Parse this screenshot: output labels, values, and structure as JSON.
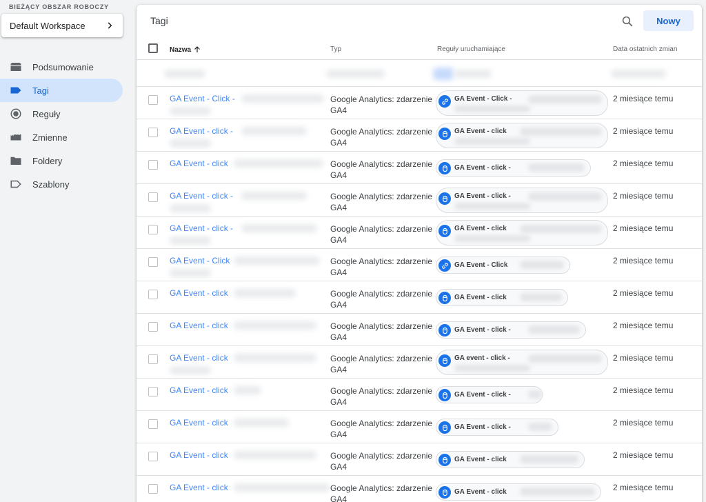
{
  "workspace": {
    "label": "BIEŻĄCY OBSZAR ROBOCZY",
    "name": "Default Workspace"
  },
  "nav": [
    {
      "id": "summary",
      "label": "Podsumowanie",
      "icon": "summary-icon"
    },
    {
      "id": "tags",
      "label": "Tagi",
      "icon": "tag-icon",
      "active": true
    },
    {
      "id": "triggers",
      "label": "Reguły",
      "icon": "trigger-icon"
    },
    {
      "id": "variables",
      "label": "Zmienne",
      "icon": "variable-icon"
    },
    {
      "id": "folders",
      "label": "Foldery",
      "icon": "folder-icon"
    },
    {
      "id": "templates",
      "label": "Szablony",
      "icon": "template-icon"
    }
  ],
  "main": {
    "title": "Tagi",
    "new_button": "Nowy",
    "columns": {
      "name": "Nazwa",
      "type": "Typ",
      "triggers": "Reguły uruchamiające",
      "date": "Data ostatnich zmian"
    }
  },
  "colors": {
    "accent": "#1a73e8",
    "link": "#4285f4",
    "active_nav_bg": "#d2e3fc"
  },
  "rows": [
    {
      "name": "GA Event - Click -",
      "type_line1": "Google Analytics: zdarzenie",
      "type_line2": "GA4",
      "trigger": "GA Event - Click -",
      "trigger_icon": "link-icon",
      "date": "2 miesiące temu"
    },
    {
      "name": "GA Event - click -",
      "type_line1": "Google Analytics: zdarzenie",
      "type_line2": "GA4",
      "trigger": "GA Event - click",
      "trigger_icon": "mouse-icon",
      "date": "2 miesiące temu"
    },
    {
      "name": "GA Event - click",
      "type_line1": "Google Analytics: zdarzenie",
      "type_line2": "GA4",
      "trigger": "GA Event - click -",
      "trigger_icon": "mouse-icon",
      "date": "2 miesiące temu"
    },
    {
      "name": "GA Event - click -",
      "type_line1": "Google Analytics: zdarzenie",
      "type_line2": "GA4",
      "trigger": "GA Event - click -",
      "trigger_icon": "mouse-icon",
      "date": "2 miesiące temu"
    },
    {
      "name": "GA Event - click -",
      "type_line1": "Google Analytics: zdarzenie",
      "type_line2": "GA4",
      "trigger": "GA Event - click",
      "trigger_icon": "mouse-icon",
      "date": "2 miesiące temu"
    },
    {
      "name": "GA Event - Click",
      "type_line1": "Google Analytics: zdarzenie",
      "type_line2": "GA4",
      "trigger": "GA Event - Click",
      "trigger_icon": "link-icon",
      "date": "2 miesiące temu"
    },
    {
      "name": "GA Event - click",
      "type_line1": "Google Analytics: zdarzenie",
      "type_line2": "GA4",
      "trigger": "GA Event - click",
      "trigger_icon": "mouse-icon",
      "date": "2 miesiące temu"
    },
    {
      "name": "GA Event - click",
      "type_line1": "Google Analytics: zdarzenie",
      "type_line2": "GA4",
      "trigger": "GA Event - click -",
      "trigger_icon": "mouse-icon",
      "date": "2 miesiące temu"
    },
    {
      "name": "GA Event - click",
      "type_line1": "Google Analytics: zdarzenie",
      "type_line2": "GA4",
      "trigger": "GA event - click -",
      "trigger_icon": "mouse-icon",
      "date": "2 miesiące temu"
    },
    {
      "name": "GA Event - click",
      "type_line1": "Google Analytics: zdarzenie",
      "type_line2": "GA4",
      "trigger": "GA Event - click -",
      "trigger_icon": "mouse-icon",
      "date": "2 miesiące temu"
    },
    {
      "name": "GA Event - click",
      "type_line1": "Google Analytics: zdarzenie",
      "type_line2": "GA4",
      "trigger": "GA Event - click -",
      "trigger_icon": "mouse-icon",
      "date": "2 miesiące temu"
    },
    {
      "name": "GA Event - click",
      "type_line1": "Google Analytics: zdarzenie",
      "type_line2": "GA4",
      "trigger": "GA Event - click",
      "trigger_icon": "mouse-icon",
      "date": "2 miesiące temu"
    },
    {
      "name": "GA Event - click",
      "type_line1": "Google Analytics: zdarzenie",
      "type_line2": "GA4",
      "trigger": "GA Event - click",
      "trigger_icon": "mouse-icon",
      "date": "2 miesiące temu"
    }
  ]
}
